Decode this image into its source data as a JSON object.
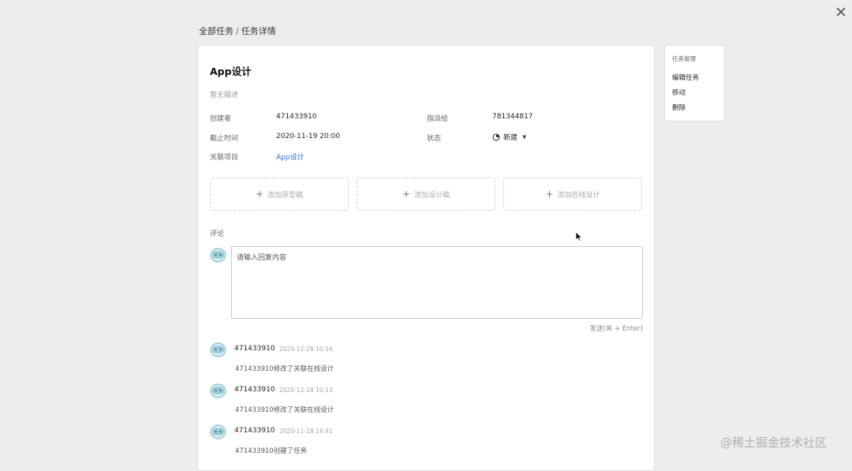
{
  "breadcrumb": {
    "parent": "全部任务",
    "separator": "/",
    "current": "任务详情"
  },
  "task": {
    "title": "App设计",
    "description": "暂无描述",
    "fields": {
      "creator_label": "创建者",
      "creator": "471433910",
      "assignee_label": "指派给",
      "assignee": "781344817",
      "deadline_label": "截止时间",
      "deadline": "2020-11-19 20:00",
      "status_label": "状态",
      "status": "新建",
      "project_label": "关联项目",
      "project": "App设计"
    }
  },
  "add_buttons": {
    "prototype": "添加原型稿",
    "design": "添加设计稿",
    "online_design": "添加在线设计"
  },
  "comments": {
    "section_label": "评论",
    "placeholder": "请输入回复内容",
    "send_hint": "发送(⌘ + Enter)",
    "items": [
      {
        "user": "471433910",
        "time": "2020-12-28 10:14",
        "text": "471433910修改了关联在线设计"
      },
      {
        "user": "471433910",
        "time": "2020-12-28 10:13",
        "text": "471433910修改了关联在线设计"
      },
      {
        "user": "471433910",
        "time": "2020-11-18 14:41",
        "text": "471433910创建了任务"
      }
    ]
  },
  "side_panel": {
    "title": "任务管理",
    "items": [
      "编辑任务",
      "移动",
      "删除"
    ]
  },
  "watermark": "@稀土掘金技术社区",
  "colors": {
    "link": "#2f6fd6",
    "avatar": "#8fc8d8",
    "background": "#ededed"
  }
}
